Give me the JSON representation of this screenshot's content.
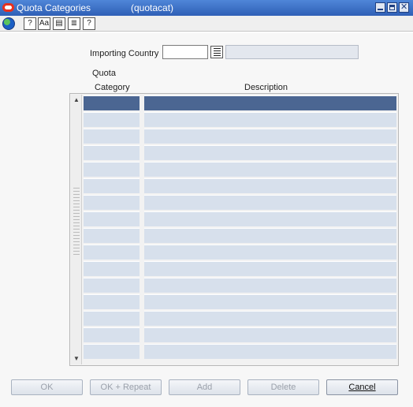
{
  "window": {
    "title": "Quota Categories",
    "code": "(quotacat)"
  },
  "toolbar": {
    "buttons": [
      {
        "icon": "globe-icon"
      },
      {
        "icon": "help-question-icon",
        "glyph": "?"
      },
      {
        "icon": "spelling-icon",
        "glyph": "Aa"
      },
      {
        "icon": "notes-icon",
        "glyph": "▤"
      },
      {
        "icon": "attachments-icon",
        "glyph": "≣"
      },
      {
        "icon": "help-icon",
        "glyph": "?"
      }
    ]
  },
  "form": {
    "importing_country_label": "Importing Country",
    "importing_country_value": "",
    "importing_country_desc": ""
  },
  "grid": {
    "header_category_line1": "Quota",
    "header_category_line2": "Category",
    "header_description": "Description",
    "rows": [
      {
        "category": "",
        "description": ""
      },
      {
        "category": "",
        "description": ""
      },
      {
        "category": "",
        "description": ""
      },
      {
        "category": "",
        "description": ""
      },
      {
        "category": "",
        "description": ""
      },
      {
        "category": "",
        "description": ""
      },
      {
        "category": "",
        "description": ""
      },
      {
        "category": "",
        "description": ""
      },
      {
        "category": "",
        "description": ""
      },
      {
        "category": "",
        "description": ""
      },
      {
        "category": "",
        "description": ""
      },
      {
        "category": "",
        "description": ""
      },
      {
        "category": "",
        "description": ""
      },
      {
        "category": "",
        "description": ""
      },
      {
        "category": "",
        "description": ""
      },
      {
        "category": "",
        "description": ""
      }
    ]
  },
  "buttons": {
    "ok": "OK",
    "ok_repeat": "OK + Repeat",
    "add": "Add",
    "delete": "Delete",
    "cancel": "Cancel"
  },
  "colors": {
    "titlebar": "#2f5fb6",
    "row_selected": "#4b6692",
    "row": "#d7e0ec"
  }
}
